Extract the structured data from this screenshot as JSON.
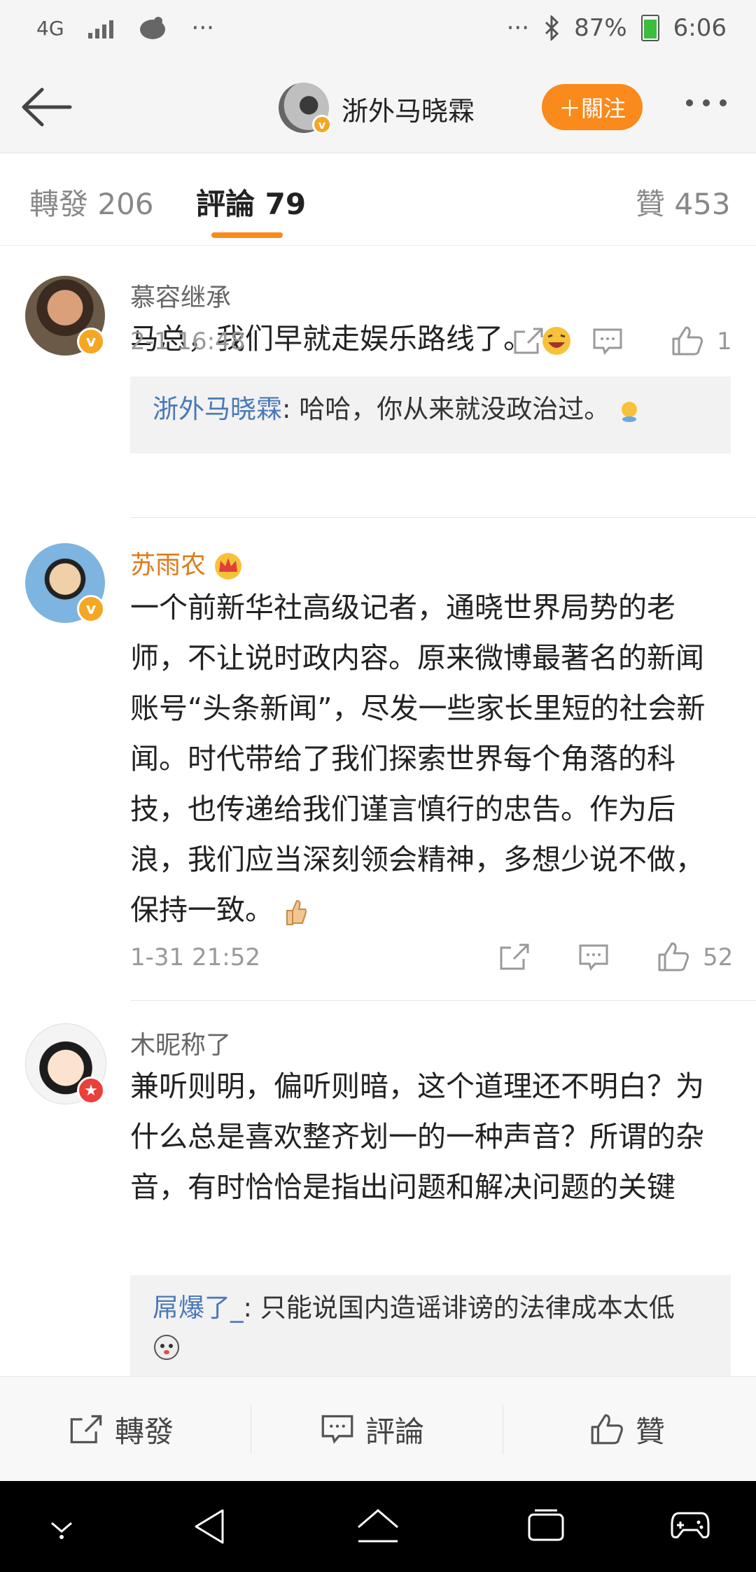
{
  "status_bar": {
    "network": "4G",
    "dots_left": "···",
    "dots_right": "···",
    "battery": "87%",
    "time": "6:06"
  },
  "header": {
    "back_icon": "back-arrow-icon",
    "user_name": "浙外马晓霖",
    "follow_label": "＋關注",
    "more_icon": "more-dots-icon"
  },
  "tabs": {
    "repost": "轉發 206",
    "comments": "評論 79",
    "likes": "贊 453"
  },
  "comments": [
    {
      "name": "慕容继承",
      "text": "马总，我们早就走娱乐路线了。",
      "reply_name": "浙外马晓霖",
      "reply_text": ": 哈哈，你从来就没政治过。",
      "time": "2-1 16:48",
      "likes": "1"
    },
    {
      "name": "苏雨农",
      "text": "一个前新华社高级记者，通晓世界局势的老师，不让说时政内容。原来微博最著名的新闻账号“头条新闻”，尽发一些家长里短的社会新闻。时代带给了我们探索世界每个角落的科技，也传递给我们谨言慎行的忠告。作为后浪，我们应当深刻领会精神，多想少说不做，保持一致。",
      "time": "1-31 21:52",
      "likes": "52"
    },
    {
      "name": "木昵称了",
      "text": "兼听则明，偏听则暗，这个道理还不明白？为什么总是喜欢整齐划一的一种声音？所谓的杂音，有时恰恰是指出问题和解决问题的关键",
      "reply_name": "屌爆了_",
      "reply_text": ": 只能说国内造谣诽谤的法律成本太低"
    }
  ],
  "bottom_bar": {
    "repost": "轉發",
    "comment": "評論",
    "like": "贊"
  },
  "colors": {
    "accent": "#f98a1b",
    "link": "#4a78b8",
    "verified": "#f5a623"
  }
}
